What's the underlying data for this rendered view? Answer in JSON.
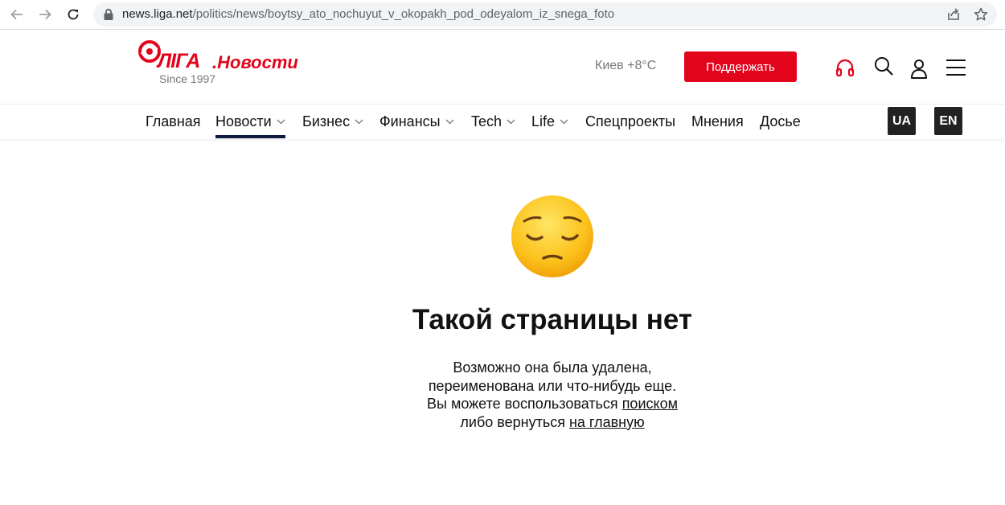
{
  "browser": {
    "url_host": "news.liga.net",
    "url_path": "/politics/news/boytsy_ato_nochuyut_v_okopakh_pod_odeyalom_iz_snega_foto",
    "icons": [
      "back-icon",
      "forward-icon",
      "reload-icon",
      "lock-icon",
      "share-icon",
      "star-icon"
    ]
  },
  "header": {
    "logo_brand": "ЛIГА",
    "logo_section": ".Новости",
    "logo_since": "Since 1997",
    "weather": "Киев +8°C",
    "support_label": "Поддержать",
    "accent_color": "#e2041b"
  },
  "menu": {
    "items": [
      {
        "label": "Главная",
        "dropdown": false
      },
      {
        "label": "Новости",
        "dropdown": true,
        "active": true
      },
      {
        "label": "Бизнес",
        "dropdown": true
      },
      {
        "label": "Финансы",
        "dropdown": true
      },
      {
        "label": "Tech",
        "dropdown": true
      },
      {
        "label": "Life",
        "dropdown": true
      },
      {
        "label": "Спецпроекты",
        "dropdown": false
      },
      {
        "label": "Мнения",
        "dropdown": false
      },
      {
        "label": "Досье",
        "dropdown": false
      }
    ],
    "languages": [
      "UA",
      "EN"
    ]
  },
  "error": {
    "emoji": "pensive-face",
    "title": "Такой страницы нет",
    "line1": "Возможно она была удалена,",
    "line2": "переименована или что-нибудь еще.",
    "line3_prefix": "Вы можете воспользоваться ",
    "line3_link": "поиском",
    "line4_prefix": "либо вернуться ",
    "line4_link": "на главную"
  }
}
